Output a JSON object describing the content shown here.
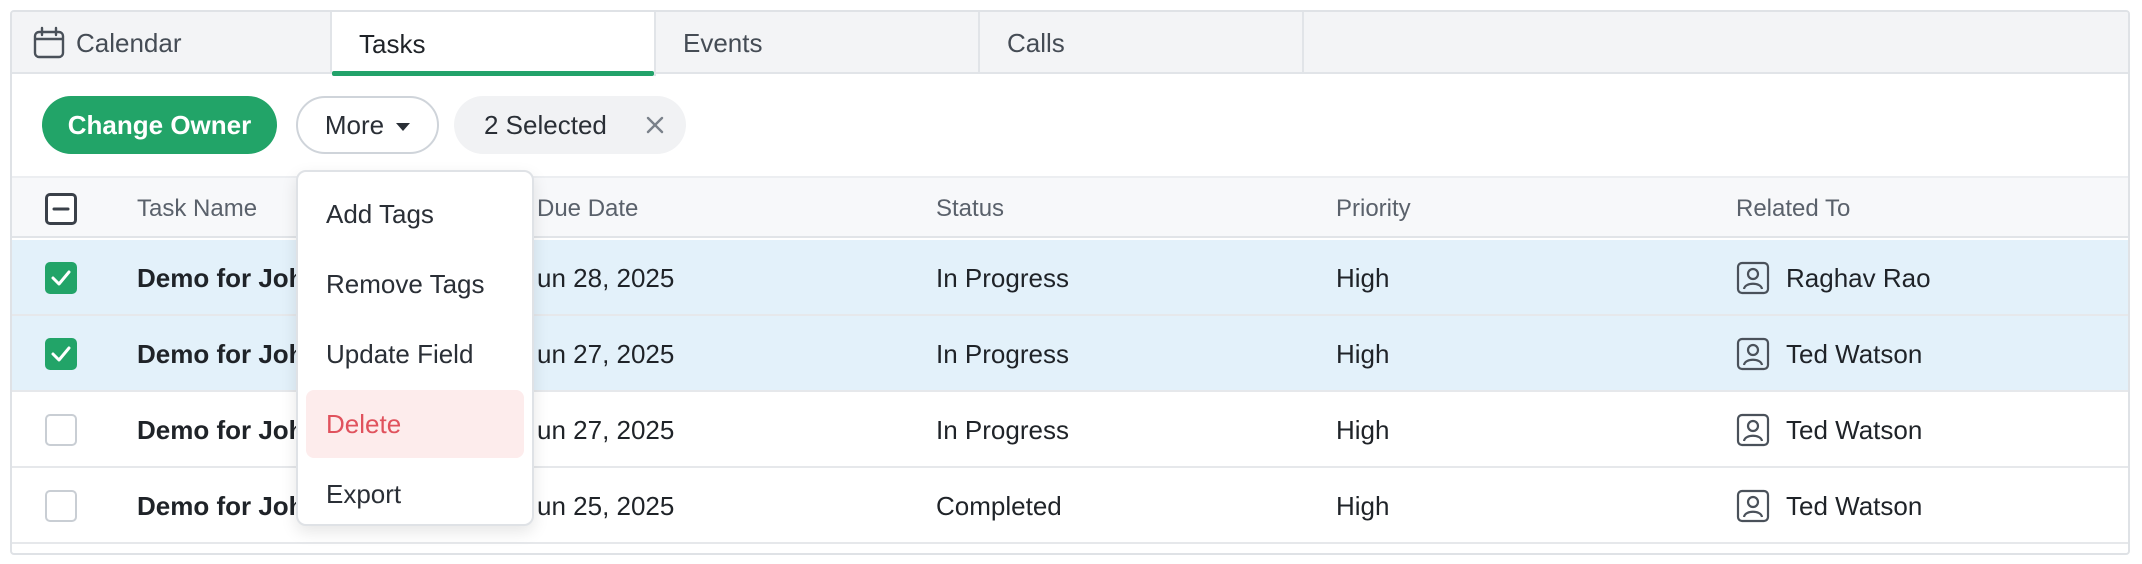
{
  "tabs": [
    {
      "label": "Calendar",
      "icon": "calendar-icon",
      "active": false
    },
    {
      "label": "Tasks",
      "active": true
    },
    {
      "label": "Events",
      "active": false
    },
    {
      "label": "Calls",
      "active": false
    }
  ],
  "toolbar": {
    "change_owner_label": "Change Owner",
    "more_label": "More",
    "selected_label": "2 Selected"
  },
  "menu": {
    "items": [
      "Add Tags",
      "Remove Tags",
      "Update Field",
      "Delete",
      "Export"
    ],
    "highlighted_item": "Delete"
  },
  "table": {
    "columns": [
      "Task Name",
      "Due Date",
      "Status",
      "Priority",
      "Related To"
    ],
    "rows": [
      {
        "selected": true,
        "task_name": "Demo for Joh",
        "due_date": "un 28, 2025",
        "status": "In Progress",
        "priority": "High",
        "related_to": "Raghav Rao"
      },
      {
        "selected": true,
        "task_name": "Demo for Joh",
        "due_date": "un 27, 2025",
        "status": "In Progress",
        "priority": "High",
        "related_to": "Ted Watson"
      },
      {
        "selected": false,
        "task_name": "Demo for Joh",
        "due_date": "un 27, 2025",
        "status": "In Progress",
        "priority": "High",
        "related_to": "Ted Watson"
      },
      {
        "selected": false,
        "task_name": "Demo for Joh",
        "due_date": "un 25, 2025",
        "status": "Completed",
        "priority": "High",
        "related_to": "Ted Watson"
      }
    ]
  },
  "colors": {
    "accent": "#22a468",
    "selected_row": "#e3f1fa",
    "danger": "#e0525d",
    "danger_bg": "#fdecec"
  }
}
